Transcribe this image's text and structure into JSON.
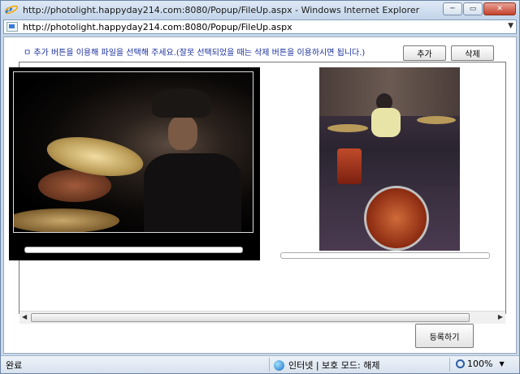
{
  "window": {
    "title": "http://photolight.happyday214.com:8080/Popup/FileUp.aspx - Windows Internet Explorer",
    "minimize": "─",
    "restore": "▭",
    "close": "✕"
  },
  "address": {
    "url": "http://photolight.happyday214.com:8080/Popup/FileUp.aspx",
    "dropdown": "▼"
  },
  "page": {
    "notice": "ㅁ 추가 버튼을 이용해 파일을 선택해 주세요.(잘못 선택되었을 때는 삭제 버튼을 이용하시면 됩니다.)",
    "add_label": "추가",
    "delete_label": "삭제",
    "register_label": "등록하기"
  },
  "status": {
    "left": "완료",
    "zone": "인터넷 | 보호 모드: 해제",
    "zoom": "100%",
    "zoom_drop": "▼"
  }
}
